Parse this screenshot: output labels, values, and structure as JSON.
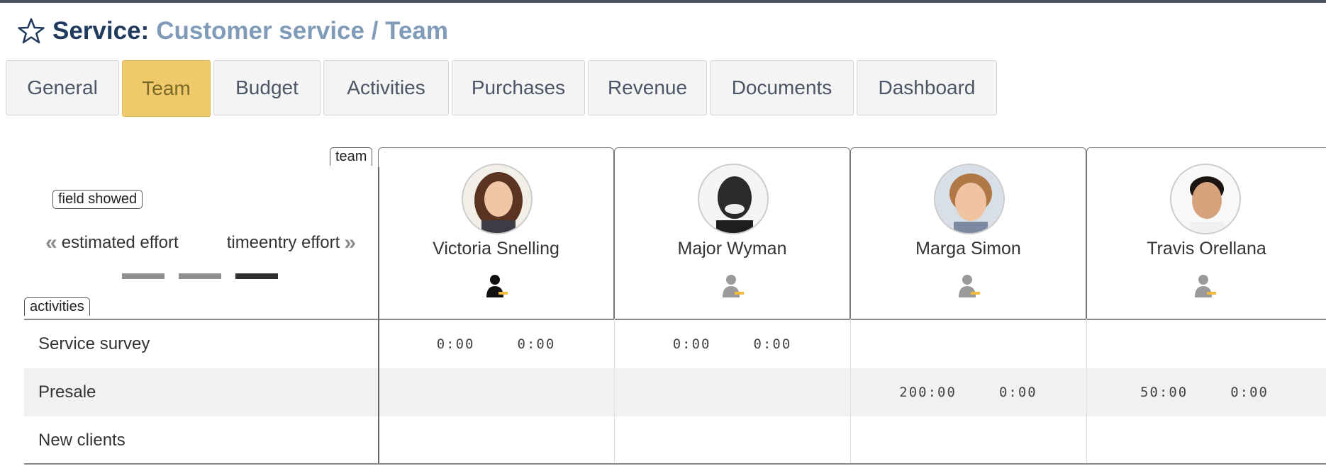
{
  "header": {
    "prefix": "Service:",
    "path": "Customer service / Team",
    "icon": "star-icon"
  },
  "tabs": [
    {
      "label": "General",
      "active": false
    },
    {
      "label": "Team",
      "active": true
    },
    {
      "label": "Budget",
      "active": false
    },
    {
      "label": "Activities",
      "active": false
    },
    {
      "label": "Purchases",
      "active": false
    },
    {
      "label": "Revenue",
      "active": false
    },
    {
      "label": "Documents",
      "active": false
    },
    {
      "label": "Dashboard",
      "active": false
    }
  ],
  "grid": {
    "team_tag": "team",
    "field_tag": "field showed",
    "activities_tag": "activities",
    "left_effort": "estimated effort",
    "right_effort": "timeentry effort",
    "members": [
      {
        "name": "Victoria Snelling",
        "role_icon": "user-role-icon"
      },
      {
        "name": "Major Wyman",
        "role_icon": "user-role-icon"
      },
      {
        "name": "Marga Simon",
        "role_icon": "user-role-icon"
      },
      {
        "name": "Travis Orellana",
        "role_icon": "user-role-icon"
      }
    ],
    "activities": [
      {
        "label": "Service survey",
        "cells": [
          [
            "0:00",
            "0:00"
          ],
          [
            "0:00",
            "0:00"
          ],
          [
            "",
            ""
          ],
          [
            "",
            ""
          ]
        ]
      },
      {
        "label": "Presale",
        "cells": [
          [
            "",
            ""
          ],
          [
            "",
            ""
          ],
          [
            "200:00",
            "0:00"
          ],
          [
            "50:00",
            "0:00"
          ]
        ]
      },
      {
        "label": "New clients",
        "cells": [
          [
            "",
            ""
          ],
          [
            "",
            ""
          ],
          [
            "",
            ""
          ],
          [
            "",
            ""
          ]
        ]
      }
    ]
  },
  "colors": {
    "active_tab": "#f0c96a",
    "title_prefix": "#203a5e",
    "title_path": "#7f9bb8"
  }
}
